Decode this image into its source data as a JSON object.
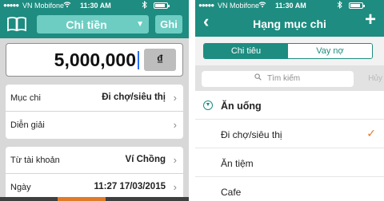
{
  "status": {
    "signal": "●●●●●",
    "carrier": "VN Mobifone",
    "time": "11:30 AM",
    "wifi_icon": "wifi-icon",
    "bluetooth_icon": "bluetooth-icon"
  },
  "left": {
    "category_select": "Chi tiền",
    "save_button": "Ghi",
    "amount": "5,000,000",
    "currency": "₫",
    "fields": [
      {
        "label": "Mục chi",
        "value": "Đi chợ/siêu thị"
      },
      {
        "label": "Diễn giải",
        "value": ""
      },
      {
        "label": "Từ tài khoản",
        "value": "Ví Chồng"
      },
      {
        "label": "Ngày",
        "value": "11:27 17/03/2015"
      }
    ]
  },
  "right": {
    "title": "Hạng mục chi",
    "tabs": [
      {
        "label": "Chi tiêu",
        "active": true
      },
      {
        "label": "Vay nợ",
        "active": false
      }
    ],
    "search_placeholder": "Tìm kiếm",
    "cancel": "Hủy",
    "group": "Ăn uống",
    "items": [
      {
        "label": "Đi chợ/siêu thị",
        "selected": true
      },
      {
        "label": "Ăn tiệm"
      },
      {
        "label": "Cafe"
      }
    ]
  },
  "colors": {
    "header": "#1e8c80",
    "accent_light": "#6dcdc2",
    "check": "#e07b2a"
  }
}
